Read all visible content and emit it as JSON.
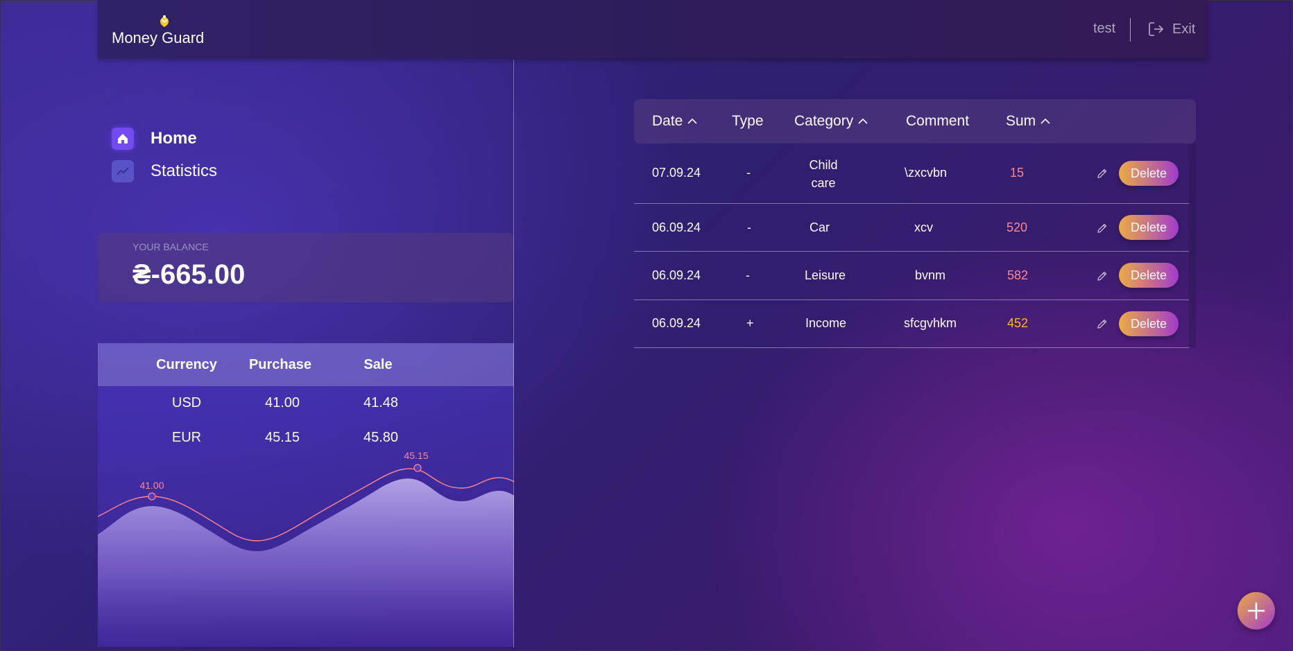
{
  "header": {
    "logo_text": "Money Guard",
    "user_name": "test",
    "exit_label": "Exit"
  },
  "sidebar": {
    "nav": [
      {
        "label": "Home",
        "icon": "home-icon",
        "active": true
      },
      {
        "label": "Statistics",
        "icon": "statistics-icon",
        "active": false
      }
    ],
    "balance": {
      "label": "YOUR BALANCE",
      "value": "₴-665.00"
    },
    "currency": {
      "headers": [
        "Currency",
        "Purchase",
        "Sale"
      ],
      "rows": [
        {
          "currency": "USD",
          "purchase": "41.00",
          "sale": "41.48"
        },
        {
          "currency": "EUR",
          "purchase": "45.15",
          "sale": "45.80"
        }
      ],
      "chart_labels": {
        "usd": "41.00",
        "eur": "45.15"
      }
    }
  },
  "transactions": {
    "headers": {
      "date": "Date",
      "type": "Type",
      "category": "Category",
      "comment": "Comment",
      "sum": "Sum"
    },
    "rows": [
      {
        "date": "07.09.24",
        "type": "-",
        "category": "Child care",
        "comment": "\\zxcvbn",
        "sum": "15",
        "delete_label": "Delete"
      },
      {
        "date": "06.09.24",
        "type": "-",
        "category": "Car",
        "comment": "xcv",
        "sum": "520",
        "delete_label": "Delete"
      },
      {
        "date": "06.09.24",
        "type": "-",
        "category": "Leisure",
        "comment": "bvnm",
        "sum": "582",
        "delete_label": "Delete"
      },
      {
        "date": "06.09.24",
        "type": "+",
        "category": "Income",
        "comment": "sfcgvhkm",
        "sum": "452",
        "delete_label": "Delete"
      }
    ]
  },
  "colors": {
    "expense": "#ff868d",
    "income": "#ffb627",
    "accent": "#734aef",
    "button_gradient_start": "#ebac44",
    "button_gradient_end": "#a13acd"
  }
}
